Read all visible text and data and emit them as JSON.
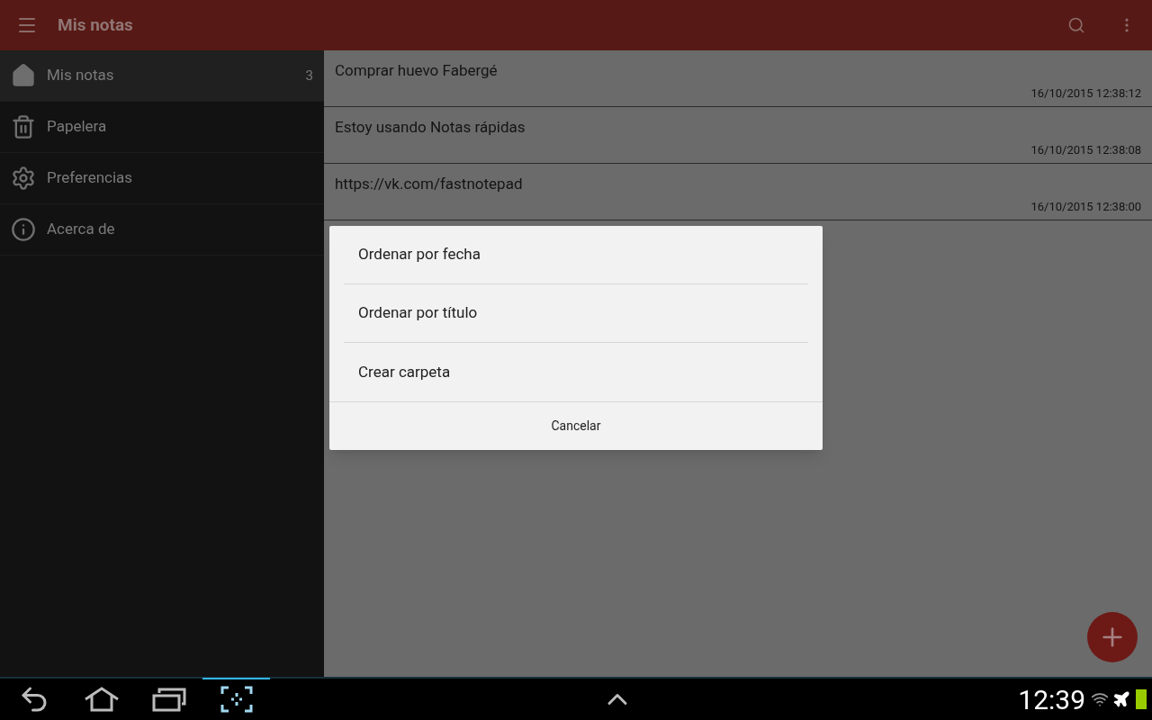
{
  "app_bar": {
    "title": "Mis notas"
  },
  "sidebar": {
    "items": [
      {
        "kind": "home",
        "label": "Mis notas",
        "count": "3",
        "selected": true
      },
      {
        "kind": "trash",
        "label": "Papelera",
        "selected": false
      },
      {
        "kind": "settings",
        "label": "Preferencias",
        "selected": false
      },
      {
        "kind": "info",
        "label": "Acerca de",
        "selected": false
      }
    ]
  },
  "notes": [
    {
      "title": "Comprar huevo Fabergé",
      "date": "16/10/2015 12:38:12"
    },
    {
      "title": "Estoy usando Notas rápidas",
      "date": "16/10/2015 12:38:08"
    },
    {
      "title": "https://vk.com/fastnotepad",
      "date": "16/10/2015 12:38:00"
    }
  ],
  "dialog": {
    "options": [
      "Ordenar por fecha",
      "Ordenar por título",
      "Crear carpeta"
    ],
    "cancel": "Cancelar"
  },
  "system_bar": {
    "buttons": [
      {
        "kind": "back",
        "selected": false
      },
      {
        "kind": "home",
        "selected": false
      },
      {
        "kind": "recents",
        "selected": false
      },
      {
        "kind": "screenshot",
        "selected": true
      }
    ],
    "time": "12:39"
  }
}
